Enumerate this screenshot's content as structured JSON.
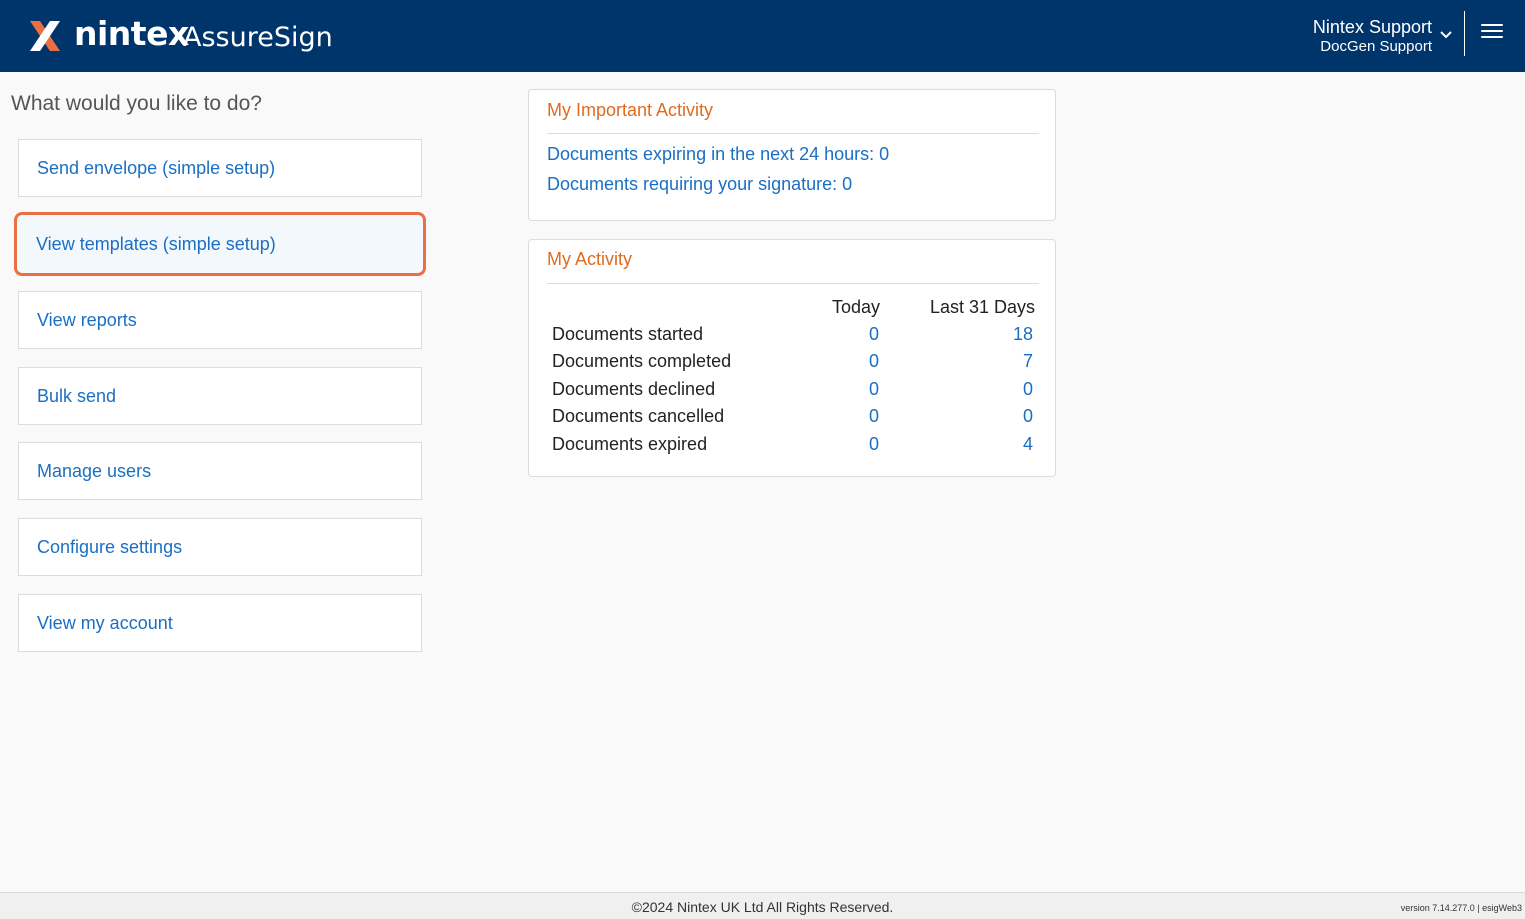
{
  "header": {
    "brand_name": "nintex",
    "brand_product": "AssureSign",
    "user_name": "Nintex Support",
    "user_org": "DocGen Support",
    "logo_icon": "nintex-x-logo",
    "chevron_icon": "chevron-down-icon",
    "menu_icon": "hamburger-menu-icon",
    "colors": {
      "bar": "#00356b",
      "logo_accent": "#ec6f44"
    }
  },
  "main": {
    "prompt": "What would you like to do?",
    "actions": [
      {
        "label": "Send envelope (simple setup)"
      },
      {
        "label": "View templates (simple setup)",
        "selected": true
      },
      {
        "label": "View reports"
      },
      {
        "label": "Bulk send"
      },
      {
        "label": "Manage users"
      },
      {
        "label": "Configure settings"
      },
      {
        "label": "View my account"
      }
    ]
  },
  "important_activity": {
    "title": "My Important Activity",
    "links": [
      "Documents expiring in the next 24 hours: 0",
      "Documents requiring your signature: 0"
    ]
  },
  "activity": {
    "title": "My Activity",
    "columns": [
      "Today",
      "Last 31 Days"
    ],
    "rows": [
      {
        "label": "Documents started",
        "today": "0",
        "last31": "18"
      },
      {
        "label": "Documents completed",
        "today": "0",
        "last31": "7"
      },
      {
        "label": "Documents declined",
        "today": "0",
        "last31": "0"
      },
      {
        "label": "Documents cancelled",
        "today": "0",
        "last31": "0"
      },
      {
        "label": "Documents expired",
        "today": "0",
        "last31": "4"
      }
    ]
  },
  "footer": {
    "copyright": "©2024 Nintex UK Ltd All Rights Reserved.",
    "version": "version 7.14.277.0 | esigWeb3"
  }
}
